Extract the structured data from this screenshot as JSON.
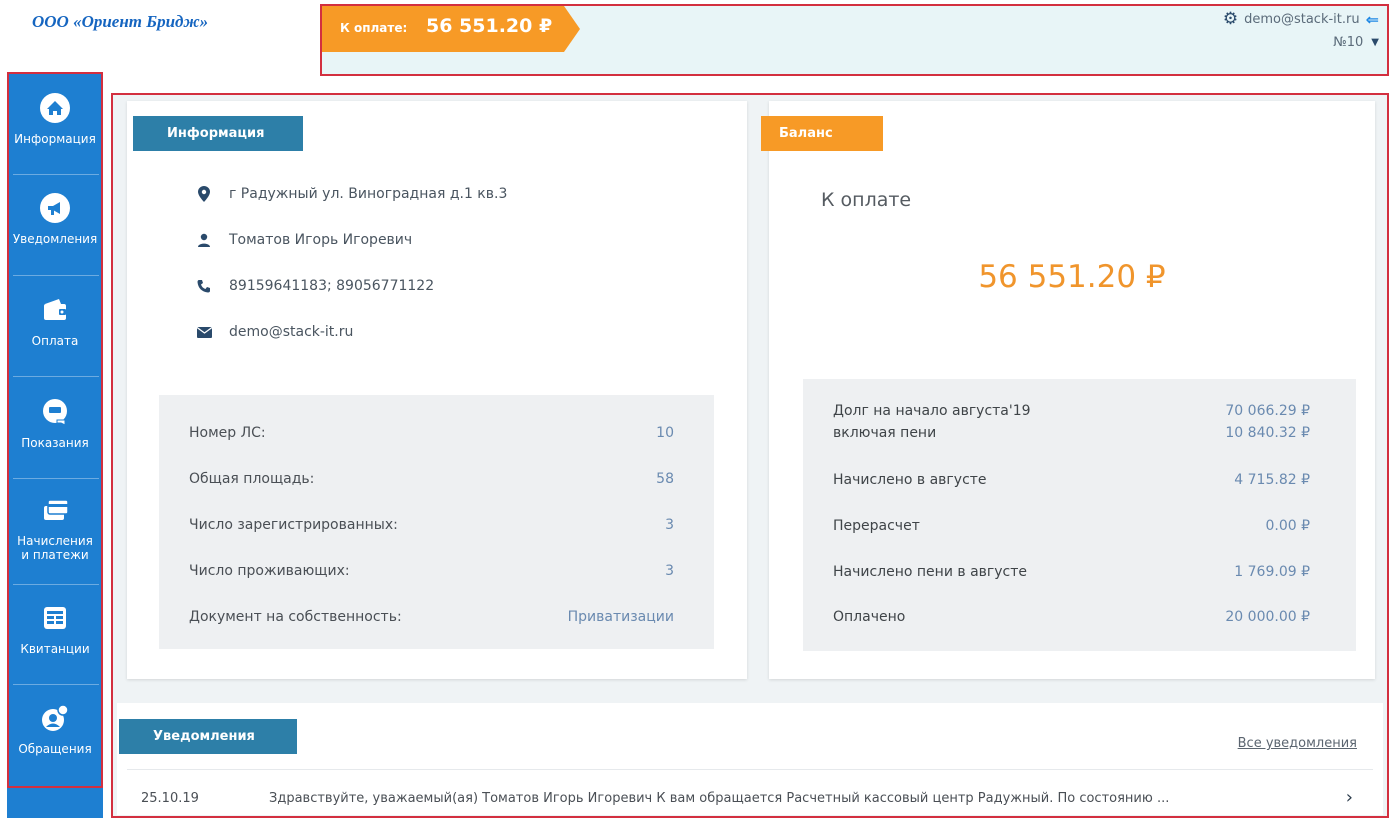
{
  "header": {
    "company": "ООО «Ориент Бридж»",
    "pay_label": "К оплате:",
    "pay_amount": "56 551.20 ₽",
    "user_email": "demo@stack-it.ru",
    "account_number": "№10"
  },
  "sidebar": {
    "items": [
      {
        "label": "Информация",
        "icon": "home-icon"
      },
      {
        "label": "Уведомления",
        "icon": "megaphone-icon"
      },
      {
        "label": "Оплата",
        "icon": "wallet-icon"
      },
      {
        "label": "Показания",
        "icon": "meter-icon"
      },
      {
        "label": "Начисления и платежи",
        "line1": "Начисления",
        "line2": "и платежи",
        "icon": "card-icon"
      },
      {
        "label": "Квитанции",
        "icon": "receipt-icon"
      },
      {
        "label": "Обращения",
        "icon": "support-icon"
      }
    ]
  },
  "info": {
    "title": "Информация",
    "address": "г Радужный ул. Виноградная д.1 кв.3",
    "name": "Томатов Игорь Игоревич",
    "phones": "89159641183; 89056771122",
    "email": "demo@stack-it.ru",
    "rows": [
      {
        "label": "Номер ЛС:",
        "value": "10"
      },
      {
        "label": "Общая площадь:",
        "value": "58"
      },
      {
        "label": "Число зарегистрированных:",
        "value": "3"
      },
      {
        "label": "Число проживающих:",
        "value": "3"
      },
      {
        "label": "Документ на собственность:",
        "value": "Приватизации"
      }
    ]
  },
  "balance": {
    "title": "Баланс",
    "to_pay_label": "К оплате",
    "to_pay_amount": "56 551.20  ₽",
    "debt_label": "Долг на начало августа'19",
    "debt_value": "70 066.29  ₽",
    "penalty_incl_label": "включая пени",
    "penalty_incl_value": "10 840.32  ₽",
    "rows": [
      {
        "label": "Начислено в августе",
        "value": "4 715.82  ₽"
      },
      {
        "label": "Перерасчет",
        "value": "0.00  ₽"
      },
      {
        "label": "Начислено пени в августе",
        "value": "1 769.09  ₽"
      },
      {
        "label": "Оплачено",
        "value": "20 000.00  ₽"
      }
    ]
  },
  "notifications": {
    "title": "Уведомления",
    "all_link": "Все уведомления",
    "items": [
      {
        "date": "25.10.19",
        "text": "Здравствуйте, уважаемый(ая) Томатов Игорь Игоревич К вам обращается Расчетный кассовый центр Радужный. По состоянию ..."
      }
    ]
  },
  "colors": {
    "accent_orange": "#f79a26",
    "sidebar_blue": "#1e7fd1",
    "badge_blue": "#2d7fa8",
    "frame_red": "#d32f3f"
  }
}
